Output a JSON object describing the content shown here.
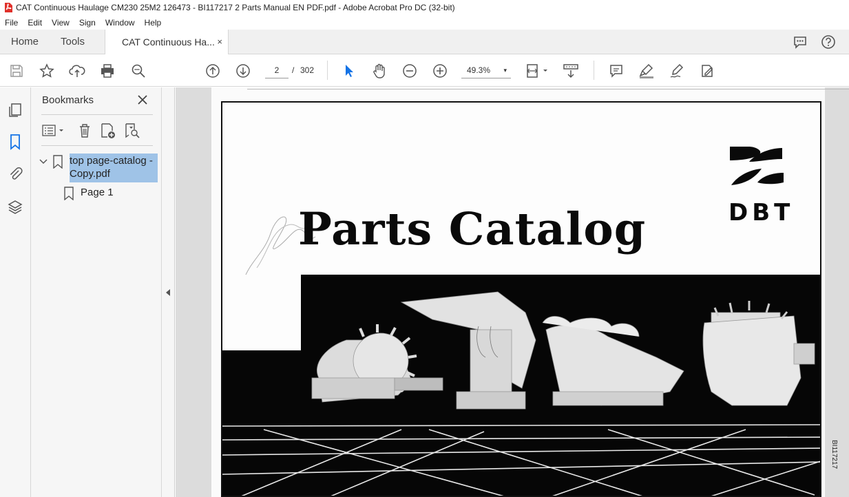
{
  "window": {
    "title": "CAT Continuous Haulage CM230 25M2 126473 - BI117217 2 Parts Manual EN PDF.pdf - Adobe Acrobat Pro DC (32-bit)"
  },
  "menu": [
    "File",
    "Edit",
    "View",
    "Sign",
    "Window",
    "Help"
  ],
  "tabs": {
    "home": "Home",
    "tools": "Tools",
    "document": "CAT Continuous Ha...",
    "close": "×"
  },
  "toolbar": {
    "page_current": "2",
    "page_separator": "/",
    "page_total": "302",
    "zoom": "49.3%",
    "zoom_caret": "▾"
  },
  "bookmarks": {
    "title": "Bookmarks",
    "items": [
      {
        "label_line1": "top page-catalog -",
        "label_line2": "Copy.pdf",
        "expanded": true,
        "selected": true
      },
      {
        "label": "Page 1"
      }
    ]
  },
  "document": {
    "title": "Parts Catalog",
    "logo_text": "DBT",
    "side_code": "BI117217"
  },
  "colors": {
    "accent_blue": "#1473e6",
    "selection": "#9fc3e7",
    "pdf_red": "#e0302a"
  }
}
